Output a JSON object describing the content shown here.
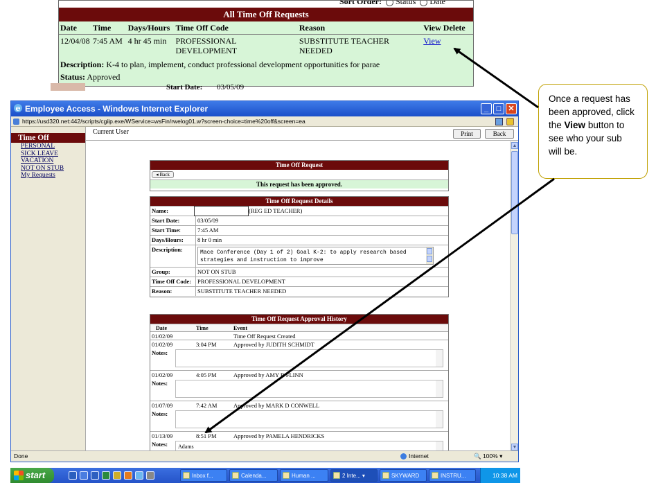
{
  "top_panel": {
    "sort_label": "Sort Order:",
    "sort_option_status": "Status",
    "sort_option_date": "Date",
    "title": "All Time Off Requests",
    "columns": [
      "Date",
      "Time",
      "Days/Hours",
      "Time Off Code",
      "Reason",
      "View Delete"
    ],
    "row": {
      "date": "12/04/08",
      "time": "7:45 AM",
      "days_hours": "4 hr 45 min",
      "time_off_code": "PROFESSIONAL DEVELOPMENT",
      "reason": "SUBSTITUTE TEACHER NEEDED",
      "view_link": "View"
    },
    "description_label": "Description:",
    "description_text": "K-4 to plan, implement, conduct professional development opportunities for parae",
    "status_label": "Status:",
    "status_text": "Approved",
    "behind_label": "Start Date:",
    "behind_value": "03/05/09"
  },
  "callout": {
    "text_before": "Once a request has been approved, click the ",
    "bold_word": "View",
    "text_after": " button to see who your sub will be."
  },
  "ie": {
    "title": "Employee Access - Windows Internet Explorer",
    "address": "https://usd320.net:442/scripts/cgiip.exe/WService=wsFin/rwelog01.w?screen-choice=time%20off&screen=ea",
    "nav_header": "Time Off",
    "nav_items": [
      "PERSONAL",
      "SICK LEAVE",
      "VACATION",
      "NOT ON STUB",
      "My Requests"
    ],
    "current_user_label": "Current User",
    "print_label": "Print",
    "back_label": "Back",
    "request_box_title": "Time Off Request",
    "back_small_label": "Back",
    "approved_message": "This request has been approved.",
    "details_title": "Time Off Request Details",
    "details": {
      "name_label": "Name:",
      "name_suffix": "(REG ED TEACHER)",
      "start_date_label": "Start Date:",
      "start_date": "03/05/09",
      "start_time_label": "Start Time:",
      "start_time": "7:45 AM",
      "days_hours_label": "Days/Hours:",
      "days_hours": "8 hr 0 min",
      "description_label": "Description:",
      "description": "Mace Conference (Day 1 of 2) Goal K-2: to apply research based strategies and instruction to improve",
      "group_label": "Group:",
      "group": "NOT ON STUB",
      "code_label": "Time Off Code:",
      "code": "PROFESSIONAL DEVELOPMENT",
      "reason_label": "Reason:",
      "reason": "SUBSTITUTE TEACHER NEEDED"
    },
    "history_title": "Time Off Request Approval History",
    "history_columns": [
      "Date",
      "Time",
      "Event"
    ],
    "notes_label": "Notes:",
    "history": [
      {
        "date": "01/02/09",
        "time": "",
        "event": "Time Off Request Created",
        "notes": null
      },
      {
        "date": "01/02/09",
        "time": "3:04 PM",
        "event": "Approved by JUDITH SCHMIDT",
        "notes": ""
      },
      {
        "date": "01/02/09",
        "time": "4:05 PM",
        "event": "Approved by AMY R FLINN",
        "notes": ""
      },
      {
        "date": "01/07/09",
        "time": "7:42 AM",
        "event": "Approved by MARK D CONWELL",
        "notes": ""
      },
      {
        "date": "01/13/09",
        "time": "8:51 PM",
        "event": "Approved by PAMELA HENDRICKS",
        "notes": "Adams"
      }
    ],
    "status_done": "Done",
    "status_zone": "Internet",
    "status_zoom": "100%"
  },
  "taskbar": {
    "start_label": "start",
    "buttons": [
      "Inbox f...",
      "Calenda...",
      "Human ...",
      "2 Inte...",
      "SKYWARD",
      "INSTRU..."
    ],
    "clock": "10:38 AM"
  }
}
